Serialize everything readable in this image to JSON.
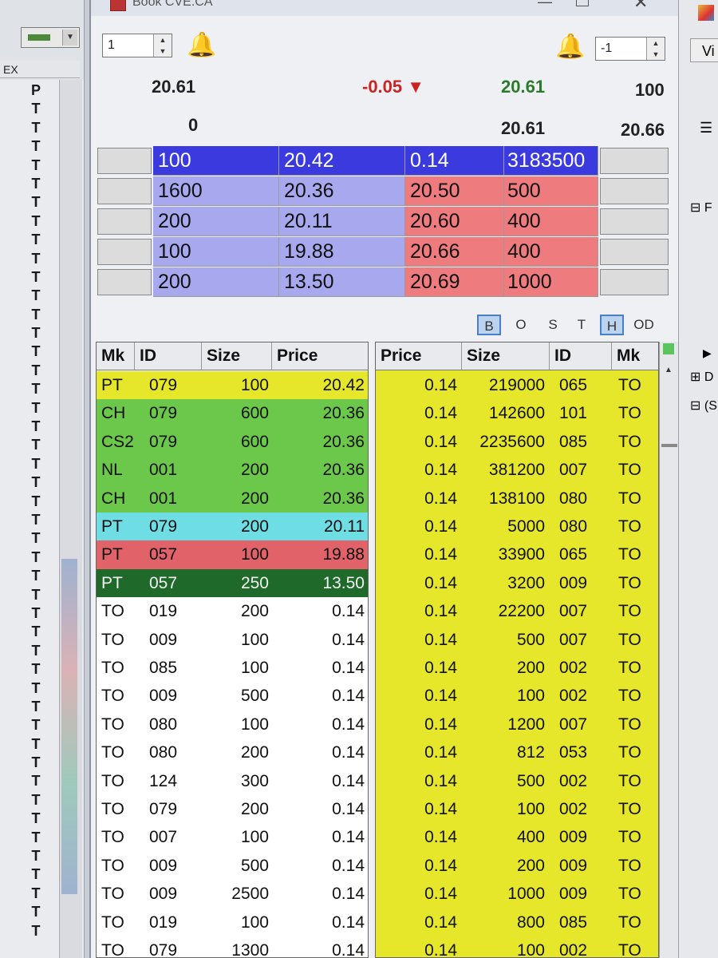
{
  "left_panel": {
    "header": "EX",
    "letters": [
      "P",
      "T",
      "T",
      "T",
      "T",
      "T",
      "T",
      "T",
      "T",
      "T",
      "T",
      "T",
      "T",
      "T",
      "T",
      "T",
      "T",
      "T",
      "T",
      "T",
      "T",
      "T",
      "T",
      "T",
      "T",
      "T",
      "T",
      "T",
      "T",
      "T",
      "T",
      "T",
      "T",
      "T",
      "T",
      "T",
      "T",
      "T",
      "T",
      "T",
      "T",
      "T",
      "T",
      "T",
      "T",
      "T"
    ]
  },
  "window": {
    "title": "Book CVE.CA",
    "left_spinner_value": "1",
    "right_spinner_value": "-1"
  },
  "quote": {
    "last": "20.61",
    "change": "-0.05",
    "change_arrow": "▼",
    "bid_price": "20.61",
    "bid_size": "100",
    "volume": "0",
    "ask_price": "20.61",
    "ask_price2": "20.66"
  },
  "colors": {
    "bid_top": "#3a3adf",
    "bid_row": "#a8a8ef",
    "ask_row": "#ee7b7e",
    "yellow": "#e6e62a",
    "green": "#6cc84a",
    "cyan": "#6fdde4",
    "red": "#e2626a",
    "dark_green": "#1f6a2a",
    "change_red": "#cc2222",
    "price_green": "#2d7a2d"
  },
  "book_rows": [
    {
      "bid_size": "100",
      "bid_price": "20.42",
      "ask_price": "0.14",
      "ask_size": "3183500"
    },
    {
      "bid_size": "1600",
      "bid_price": "20.36",
      "ask_price": "20.50",
      "ask_size": "500"
    },
    {
      "bid_size": "200",
      "bid_price": "20.11",
      "ask_price": "20.60",
      "ask_size": "400"
    },
    {
      "bid_size": "100",
      "bid_price": "19.88",
      "ask_price": "20.66",
      "ask_size": "400"
    },
    {
      "bid_size": "200",
      "bid_price": "13.50",
      "ask_price": "20.69",
      "ask_size": "1000"
    }
  ],
  "filters": [
    "B",
    "O",
    "S",
    "T",
    "H",
    "OD"
  ],
  "bid_table": {
    "headers": [
      "Mk",
      "ID",
      "Size",
      "Price"
    ],
    "rows": [
      {
        "mk": "PT",
        "id": "079",
        "size": "100",
        "price": "20.42",
        "color": "#e6e62a",
        "fg": "#111"
      },
      {
        "mk": "CH",
        "id": "079",
        "size": "600",
        "price": "20.36",
        "color": "#6cc84a",
        "fg": "#111"
      },
      {
        "mk": "CS2",
        "id": "079",
        "size": "600",
        "price": "20.36",
        "color": "#6cc84a",
        "fg": "#111"
      },
      {
        "mk": "NL",
        "id": "001",
        "size": "200",
        "price": "20.36",
        "color": "#6cc84a",
        "fg": "#111"
      },
      {
        "mk": "CH",
        "id": "001",
        "size": "200",
        "price": "20.36",
        "color": "#6cc84a",
        "fg": "#111"
      },
      {
        "mk": "PT",
        "id": "079",
        "size": "200",
        "price": "20.11",
        "color": "#6fdde4",
        "fg": "#111"
      },
      {
        "mk": "PT",
        "id": "057",
        "size": "100",
        "price": "19.88",
        "color": "#e2626a",
        "fg": "#111"
      },
      {
        "mk": "PT",
        "id": "057",
        "size": "250",
        "price": "13.50",
        "color": "#1f6a2a",
        "fg": "#f2f2f2"
      },
      {
        "mk": "TO",
        "id": "019",
        "size": "200",
        "price": "0.14",
        "color": "#ffffff",
        "fg": "#111"
      },
      {
        "mk": "TO",
        "id": "009",
        "size": "100",
        "price": "0.14",
        "color": "#ffffff",
        "fg": "#111"
      },
      {
        "mk": "TO",
        "id": "085",
        "size": "100",
        "price": "0.14",
        "color": "#ffffff",
        "fg": "#111"
      },
      {
        "mk": "TO",
        "id": "009",
        "size": "500",
        "price": "0.14",
        "color": "#ffffff",
        "fg": "#111"
      },
      {
        "mk": "TO",
        "id": "080",
        "size": "100",
        "price": "0.14",
        "color": "#ffffff",
        "fg": "#111"
      },
      {
        "mk": "TO",
        "id": "080",
        "size": "200",
        "price": "0.14",
        "color": "#ffffff",
        "fg": "#111"
      },
      {
        "mk": "TO",
        "id": "124",
        "size": "300",
        "price": "0.14",
        "color": "#ffffff",
        "fg": "#111"
      },
      {
        "mk": "TO",
        "id": "079",
        "size": "200",
        "price": "0.14",
        "color": "#ffffff",
        "fg": "#111"
      },
      {
        "mk": "TO",
        "id": "007",
        "size": "100",
        "price": "0.14",
        "color": "#ffffff",
        "fg": "#111"
      },
      {
        "mk": "TO",
        "id": "009",
        "size": "500",
        "price": "0.14",
        "color": "#ffffff",
        "fg": "#111"
      },
      {
        "mk": "TO",
        "id": "009",
        "size": "2500",
        "price": "0.14",
        "color": "#ffffff",
        "fg": "#111"
      },
      {
        "mk": "TO",
        "id": "019",
        "size": "100",
        "price": "0.14",
        "color": "#ffffff",
        "fg": "#111"
      },
      {
        "mk": "TO",
        "id": "079",
        "size": "1300",
        "price": "0.14",
        "color": "#ffffff",
        "fg": "#111"
      }
    ]
  },
  "ask_table": {
    "headers": [
      "Price",
      "Size",
      "ID",
      "Mk"
    ],
    "rows": [
      {
        "price": "0.14",
        "size": "219000",
        "id": "065",
        "mk": "TO"
      },
      {
        "price": "0.14",
        "size": "142600",
        "id": "101",
        "mk": "TO"
      },
      {
        "price": "0.14",
        "size": "2235600",
        "id": "085",
        "mk": "TO"
      },
      {
        "price": "0.14",
        "size": "381200",
        "id": "007",
        "mk": "TO"
      },
      {
        "price": "0.14",
        "size": "138100",
        "id": "080",
        "mk": "TO"
      },
      {
        "price": "0.14",
        "size": "5000",
        "id": "080",
        "mk": "TO"
      },
      {
        "price": "0.14",
        "size": "33900",
        "id": "065",
        "mk": "TO"
      },
      {
        "price": "0.14",
        "size": "3200",
        "id": "009",
        "mk": "TO"
      },
      {
        "price": "0.14",
        "size": "22200",
        "id": "007",
        "mk": "TO"
      },
      {
        "price": "0.14",
        "size": "500",
        "id": "007",
        "mk": "TO"
      },
      {
        "price": "0.14",
        "size": "200",
        "id": "002",
        "mk": "TO"
      },
      {
        "price": "0.14",
        "size": "100",
        "id": "002",
        "mk": "TO"
      },
      {
        "price": "0.14",
        "size": "1200",
        "id": "007",
        "mk": "TO"
      },
      {
        "price": "0.14",
        "size": "812",
        "id": "053",
        "mk": "TO"
      },
      {
        "price": "0.14",
        "size": "500",
        "id": "002",
        "mk": "TO"
      },
      {
        "price": "0.14",
        "size": "100",
        "id": "002",
        "mk": "TO"
      },
      {
        "price": "0.14",
        "size": "400",
        "id": "009",
        "mk": "TO"
      },
      {
        "price": "0.14",
        "size": "200",
        "id": "009",
        "mk": "TO"
      },
      {
        "price": "0.14",
        "size": "1000",
        "id": "009",
        "mk": "TO"
      },
      {
        "price": "0.14",
        "size": "800",
        "id": "085",
        "mk": "TO"
      },
      {
        "price": "0.14",
        "size": "100",
        "id": "002",
        "mk": "TO"
      }
    ]
  },
  "right_panel": {
    "top_label": "Vi",
    "tree_labels": [
      "F",
      "D",
      "(S"
    ]
  }
}
